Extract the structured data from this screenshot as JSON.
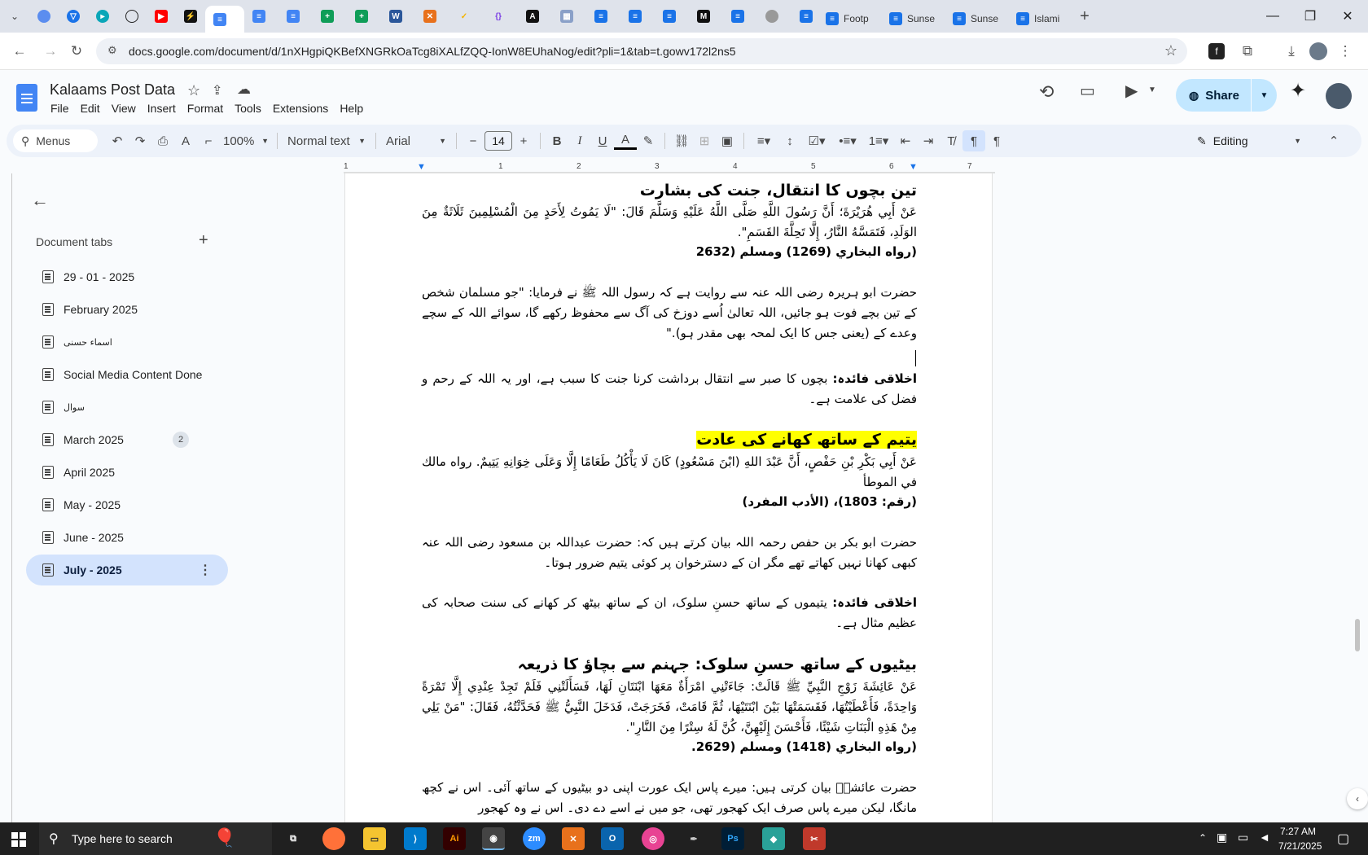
{
  "browser": {
    "tabs": [
      {
        "label": "Footp",
        "icon": "docs-icon"
      },
      {
        "label": "Sunse",
        "icon": "docs-icon"
      },
      {
        "label": "Sunse",
        "icon": "docs-icon"
      },
      {
        "label": "Islami",
        "icon": "docs-icon"
      }
    ],
    "new_tab_label": "+",
    "url": "docs.google.com/document/d/1nXHgpiQKBefXNGRkOaTcg8iXALfZQQ-IonW8EUhaNog/edit?pli=1&tab=t.gowv172l2ns5"
  },
  "docs": {
    "title": "Kalaams Post Data",
    "menu": [
      "File",
      "Edit",
      "View",
      "Insert",
      "Format",
      "Tools",
      "Extensions",
      "Help"
    ],
    "share_label": "Share",
    "toolbar": {
      "menus_label": "Menus",
      "zoom": "100%",
      "style": "Normal text",
      "font": "Arial",
      "font_size": "14",
      "mode": "Editing"
    },
    "ruler_numbers": [
      "1",
      "1",
      "2",
      "3",
      "4",
      "5",
      "6",
      "7"
    ]
  },
  "sidebar": {
    "heading": "Document tabs",
    "tabs": [
      {
        "label": "29 - 01 - 2025"
      },
      {
        "label": "February 2025"
      },
      {
        "label": "اسماء حسنی"
      },
      {
        "label": "Social Media Content Done"
      },
      {
        "label": "سوال"
      },
      {
        "label": "March 2025",
        "badge": "2"
      },
      {
        "label": "April 2025"
      },
      {
        "label": "May - 2025"
      },
      {
        "label": "June - 2025"
      },
      {
        "label": "July - 2025",
        "selected": true
      }
    ]
  },
  "document": {
    "s1": {
      "heading": "تین بچوں کا انتقال، جنت کی بشارت",
      "arabic": "عَنْ أَبِي هُرَيْرَةَ؛ أَنَّ رَسُولَ اللَّهِ صَلَّى اللَّهُ عَلَيْهِ وَسَلَّمَ قَالَ: \"لَا يَمُوتُ لِأَحَدٍ مِنَ الْمُسْلِمِينَ ثَلَاثَةٌ مِنَ الوَلَدِ، فَتَمَسَّهُ النَّارُ، إِلَّا تَحِلَّةَ القَسَمِ\".",
      "ref": "(رواه البخاري (1269) ومسلم (2632",
      "urdu": "حضرت ابو ہریرہ رضی اللہ عنہ سے روایت ہے کہ رسول اللہ ﷺ نے فرمایا: \"جو مسلمان شخص کے تین بچے فوت ہو جائیں، اللہ تعالیٰ اُسے دوزخ کی آگ سے محفوظ رکھے گا، سوائے اللہ کے سچے وعدے کے (یعنی جس کا ایک لمحہ بھی مقدر ہو).\"",
      "lesson_label": "اخلاقی فائدہ:",
      "lesson": " بچوں کا صبر سے انتقال برداشت کرنا جنت کا سبب ہے، اور یہ اللہ کے رحم و فضل کی علامت ہے۔"
    },
    "s2": {
      "heading": "یتیم کے ساتھ کھانے کی عادت",
      "arabic": "عَنْ أَبِي بَكْرِ بْنِ حَفْصٍ، أَنَّ عَبْدَ اللهِ (ابْنَ مَسْعُودٍ) كَانَ لَا يَأْكُلُ طَعَامًا إِلَّا وَعَلَى خِوَانِهِ يَتِيمٌ. رواه مالك في الموطأ",
      "ref": "(رقم: 1803)، (الأدب المفرد)",
      "urdu": "حضرت ابو بکر بن حفص رحمہ اللہ بیان کرتے ہیں کہ: حضرت عبداللہ بن مسعود رضی اللہ عنہ کبھی کھانا نہیں کھاتے تھے مگر ان کے دسترخوان پر کوئی یتیم ضرور ہوتا۔",
      "lesson_label": "اخلاقی فائدہ:",
      "lesson": " یتیموں کے ساتھ حسنِ سلوک، ان کے ساتھ بیٹھ کر کھانے کی سنت صحابہ کی عظیم مثال ہے۔"
    },
    "s3": {
      "heading": "بیٹیوں کے ساتھ حسنِ سلوک: جہنم سے بچاؤ کا ذریعہ",
      "arabic": "عَنْ عَائِشَةَ زَوْجِ النَّبِيِّ ﷺ قَالَتْ: جَاءَتْنِي امْرَأَةٌ مَعَهَا ابْنَتَانِ لَهَا، فَسَأَلَتْنِي فَلَمْ تَجِدْ عِنْدِي إِلَّا تَمْرَةً وَاحِدَةً، فَأَعْطَيْتُهَا، فَقَسَمَتْهَا بَيْنَ ابْنَتَيْهَا، ثُمَّ قَامَتْ، فَخَرَجَتْ، فَدَخَلَ النَّبِيُّ ﷺ فَحَدَّثْتُهُ، فَقَالَ: \"مَنْ يَلِي مِنْ هَذِهِ الْبَنَاتِ شَيْئًا، فَأَحْسَنَ إِلَيْهِنَّ، كُنَّ لَهُ سِتْرًا مِنَ النَّارِ\".",
      "ref": "(رواه البخاري (1418) ومسلم (2629.",
      "urdu": "حضرت عائشہؓ بیان کرتی ہیں: میرے پاس ایک عورت اپنی دو بیٹیوں کے ساتھ آئی۔ اس نے کچھ مانگا، لیکن میرے پاس صرف ایک کھجور تھی، جو میں نے اسے دے دی۔ اس نے وہ کھجور"
    }
  },
  "taskbar": {
    "search_placeholder": "Type here to search",
    "time": "7:27 AM",
    "date": "7/21/2025"
  },
  "colors": {
    "accent": "#c2e7ff",
    "selected_tab": "#d3e3fd",
    "highlight": "#ffff00",
    "docs_blue": "#4285f4"
  }
}
